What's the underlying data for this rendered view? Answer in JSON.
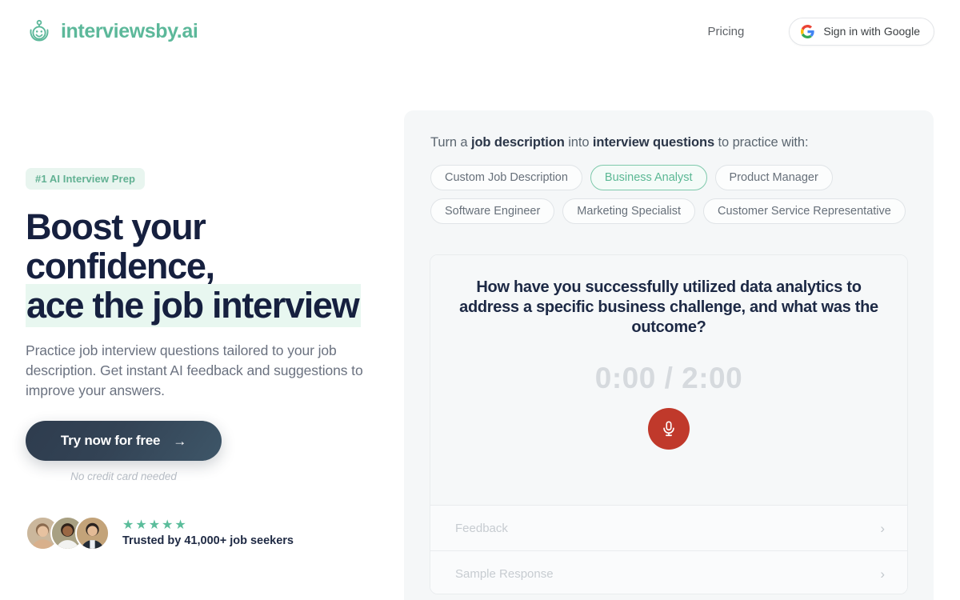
{
  "header": {
    "brand_name": "interviewsby.ai",
    "logo_icon": "robot-head-icon",
    "pricing_label": "Pricing",
    "google_signin_label": "Sign in with Google",
    "google_icon": "google-g-icon"
  },
  "hero": {
    "badge": "#1 AI Interview Prep",
    "headline_line1": "Boost your",
    "headline_line2": "confidence,",
    "headline_line3": "ace the job interview",
    "subhead": "Practice job interview questions tailored to your job description. Get instant AI feedback and suggestions to improve your answers.",
    "cta_label": "Try now for free",
    "cta_arrow": "→",
    "cta_note": "No credit card needed",
    "stars": "★★★★★",
    "proof_label": "Trusted by 41,000+ job seekers",
    "avatar_count": 3,
    "accent_green": "#5cb89a",
    "highlight_green": "#e8f7f0",
    "headline_navy": "#16203f"
  },
  "panel": {
    "title_prefix": "Turn a ",
    "title_bold1": "job description",
    "title_middle": " into ",
    "title_bold2": "interview questions",
    "title_suffix": " to practice with:",
    "chips": [
      {
        "label": "Custom Job Description",
        "active": false
      },
      {
        "label": "Business Analyst",
        "active": true
      },
      {
        "label": "Product Manager",
        "active": false
      },
      {
        "label": "Software Engineer",
        "active": false
      },
      {
        "label": "Marketing Specialist",
        "active": false
      },
      {
        "label": "Customer Service Representative",
        "active": false
      }
    ],
    "question": "How have you successfully utilized data analytics to address a specific business challenge, and what was the outcome?",
    "timer": "0:00 / 2:00",
    "mic_icon": "microphone-icon",
    "mic_color": "#c0392b",
    "accordion": [
      {
        "label": "Feedback",
        "chevron": "›"
      },
      {
        "label": "Sample Response",
        "chevron": "›"
      }
    ]
  }
}
